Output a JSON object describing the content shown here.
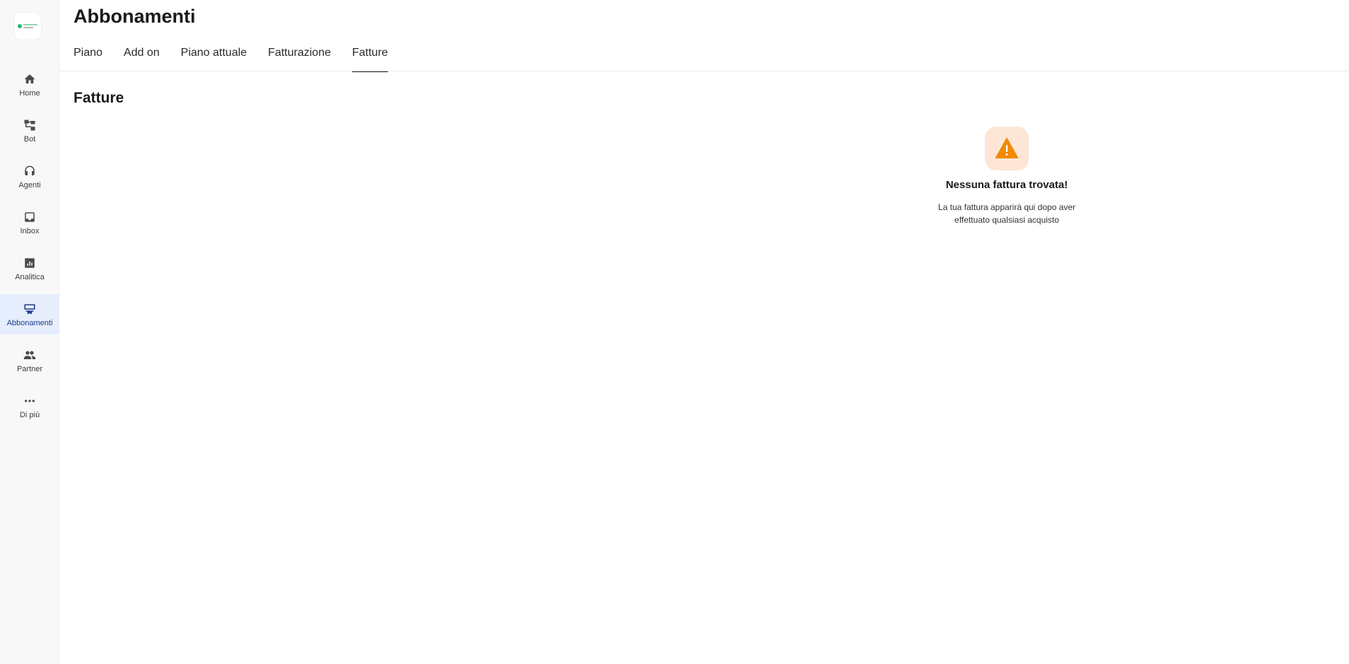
{
  "page": {
    "title": "Abbonamenti"
  },
  "sidebar": {
    "items": [
      {
        "label": "Home",
        "icon": "home-icon"
      },
      {
        "label": "Bot",
        "icon": "flow-icon"
      },
      {
        "label": "Agenti",
        "icon": "headset-icon"
      },
      {
        "label": "Inbox",
        "icon": "inbox-icon"
      },
      {
        "label": "Analitica",
        "icon": "chart-icon"
      },
      {
        "label": "Abbonamenti",
        "icon": "subscription-icon",
        "active": true
      },
      {
        "label": "Partner",
        "icon": "people-icon"
      },
      {
        "label": "Di più",
        "icon": "more-dots-icon"
      }
    ]
  },
  "tabs": [
    {
      "label": "Piano"
    },
    {
      "label": "Add on"
    },
    {
      "label": "Piano attuale"
    },
    {
      "label": "Fatturazione"
    },
    {
      "label": "Fatture",
      "active": true
    }
  ],
  "section": {
    "title": "Fatture"
  },
  "empty_state": {
    "icon": "warning-icon",
    "title": "Nessuna fattura trovata!",
    "line1": "La tua fattura apparirà qui dopo aver",
    "line2": "effettuato qualsiasi acquisto"
  },
  "colors": {
    "accent_active": "#1d3b8f",
    "active_bg": "#e6edfc",
    "warning": "#f08a00",
    "warning_bg": "#fde6d6"
  }
}
